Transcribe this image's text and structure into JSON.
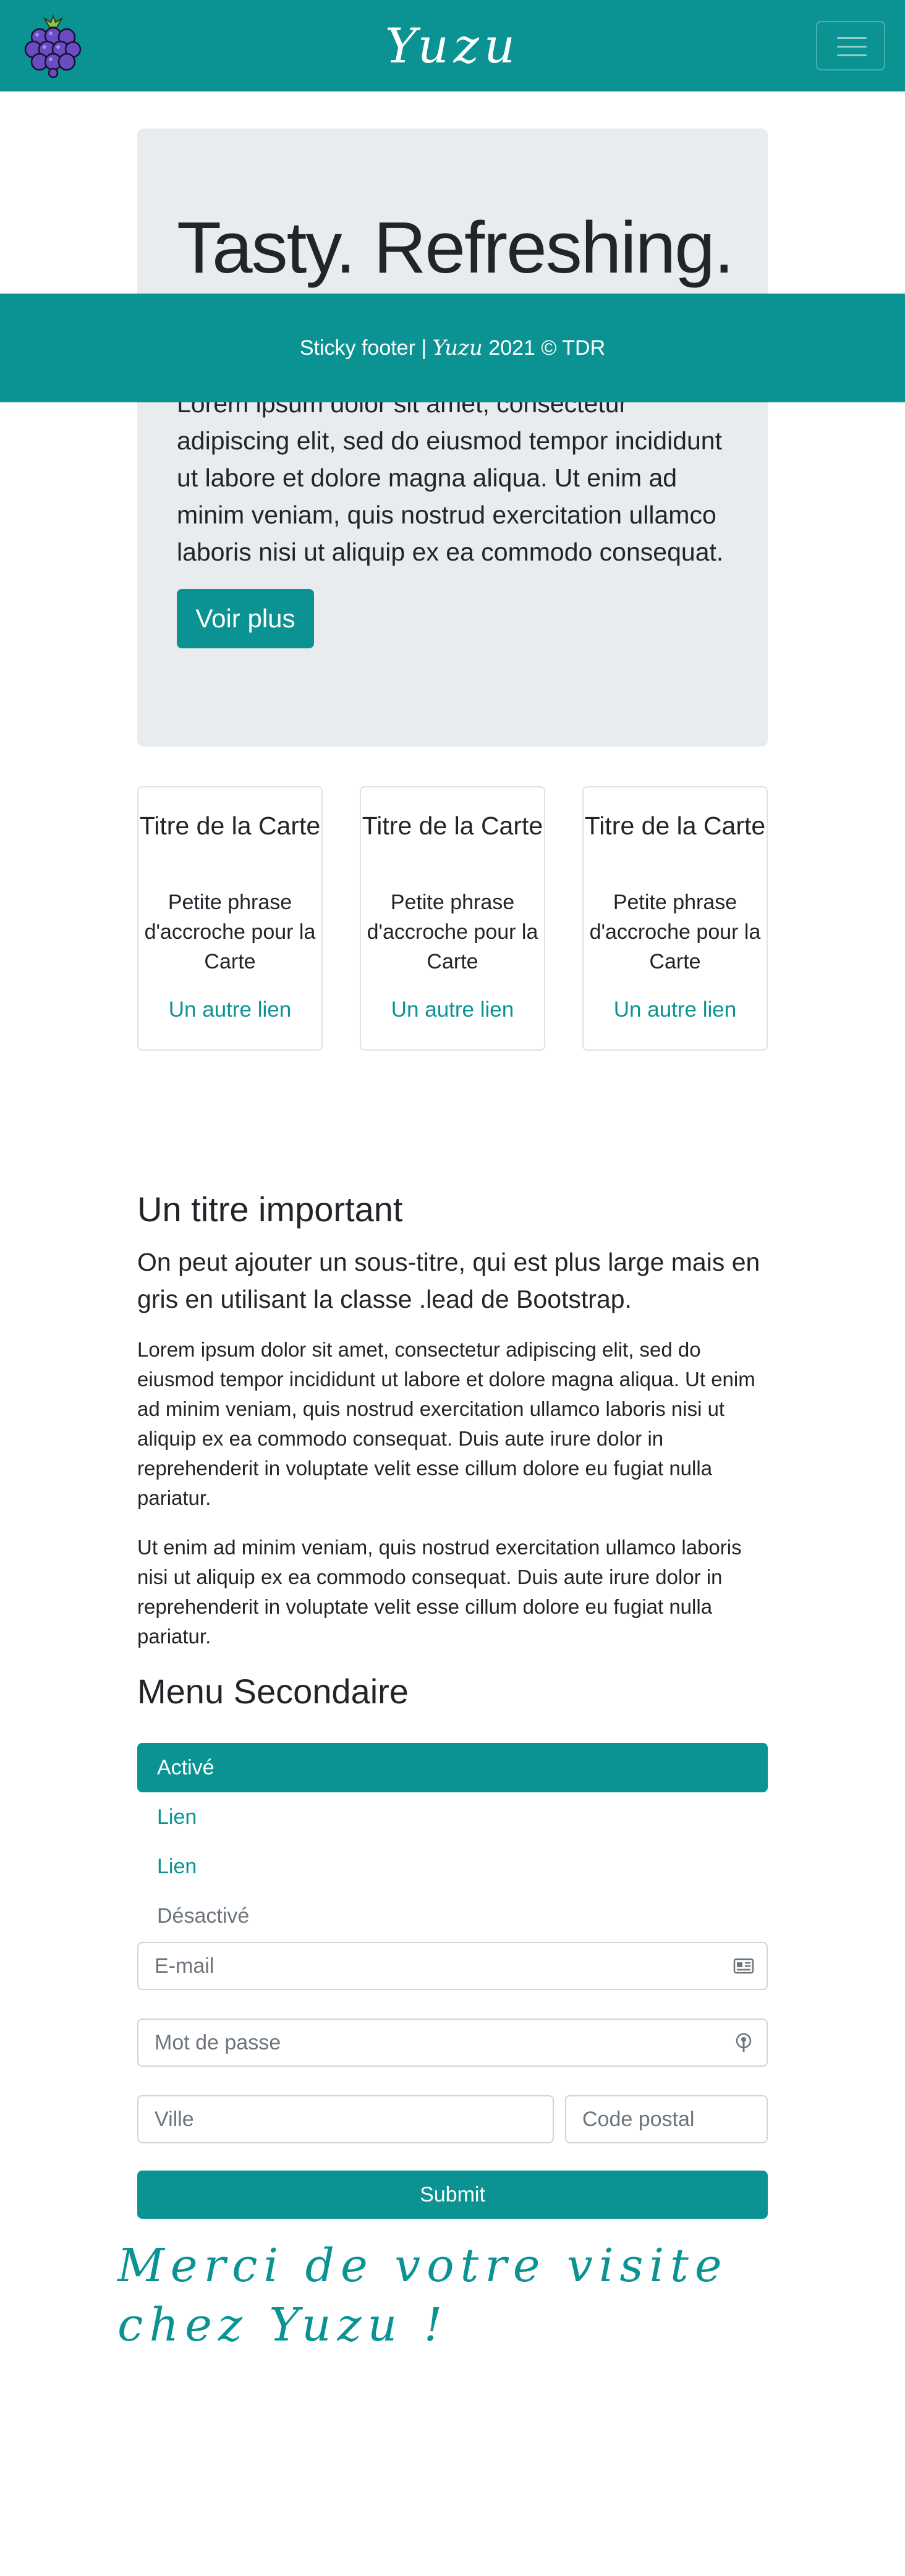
{
  "navbar": {
    "brand": "Yuzu",
    "logo_icon": "grape-logo-icon",
    "toggler_icon": "hamburger-menu-icon"
  },
  "jumbotron": {
    "title": "Tasty. Refreshing.",
    "text": "Lorem ipsum dolor sit amet, consectetur adipiscing elit, sed do eiusmod tempor incididunt ut labore et dolore magna aliqua. Ut enim ad minim veniam, quis nostrud exercitation ullamco laboris nisi ut aliquip ex ea commodo consequat.",
    "button": "Voir plus"
  },
  "sticky_footer": {
    "prefix": "Sticky footer | ",
    "brand": "Yuzu",
    "suffix": " 2021 © TDR"
  },
  "cards": [
    {
      "title": "Titre de la Carte",
      "text": "Petite phrase d'accroche pour la Carte",
      "link": "Un autre lien"
    },
    {
      "title": "Titre de la Carte",
      "text": "Petite phrase d'accroche pour la Carte",
      "link": "Un autre lien"
    },
    {
      "title": "Titre de la Carte",
      "text": "Petite phrase d'accroche pour la Carte",
      "link": "Un autre lien"
    }
  ],
  "article": {
    "heading": "Un titre important",
    "lead": "On peut ajouter un sous-titre, qui est plus large mais en gris en utilisant la classe .lead de Bootstrap.",
    "paragraph1": "Lorem ipsum dolor sit amet, consectetur adipiscing elit, sed do eiusmod tempor incididunt ut labore et dolore magna aliqua. Ut enim ad minim veniam, quis nostrud exercitation ullamco laboris nisi ut aliquip ex ea commodo consequat. Duis aute irure dolor in reprehenderit in voluptate velit esse cillum dolore eu fugiat nulla pariatur.",
    "paragraph2": "Ut enim ad minim veniam, quis nostrud exercitation ullamco laboris nisi ut aliquip ex ea commodo consequat. Duis aute irure dolor in reprehenderit in voluptate velit esse cillum dolore eu fugiat nulla pariatur."
  },
  "menu": {
    "heading": "Menu Secondaire",
    "items": [
      {
        "label": "Activé",
        "state": "active"
      },
      {
        "label": "Lien",
        "state": "link"
      },
      {
        "label": "Lien",
        "state": "link"
      },
      {
        "label": "Désactivé",
        "state": "disabled"
      }
    ]
  },
  "form": {
    "email_placeholder": "E-mail",
    "password_placeholder": "Mot de passe",
    "city_placeholder": "Ville",
    "zip_placeholder": "Code postal",
    "submit": "Submit",
    "email_icon": "id-card-icon",
    "password_icon": "key-icon"
  },
  "thanks": "Merci de votre visite chez Yuzu !",
  "colors": {
    "accent": "#0b9393",
    "jumbotron_bg": "#e9ecef",
    "text": "#212529",
    "muted": "#6c757d"
  }
}
